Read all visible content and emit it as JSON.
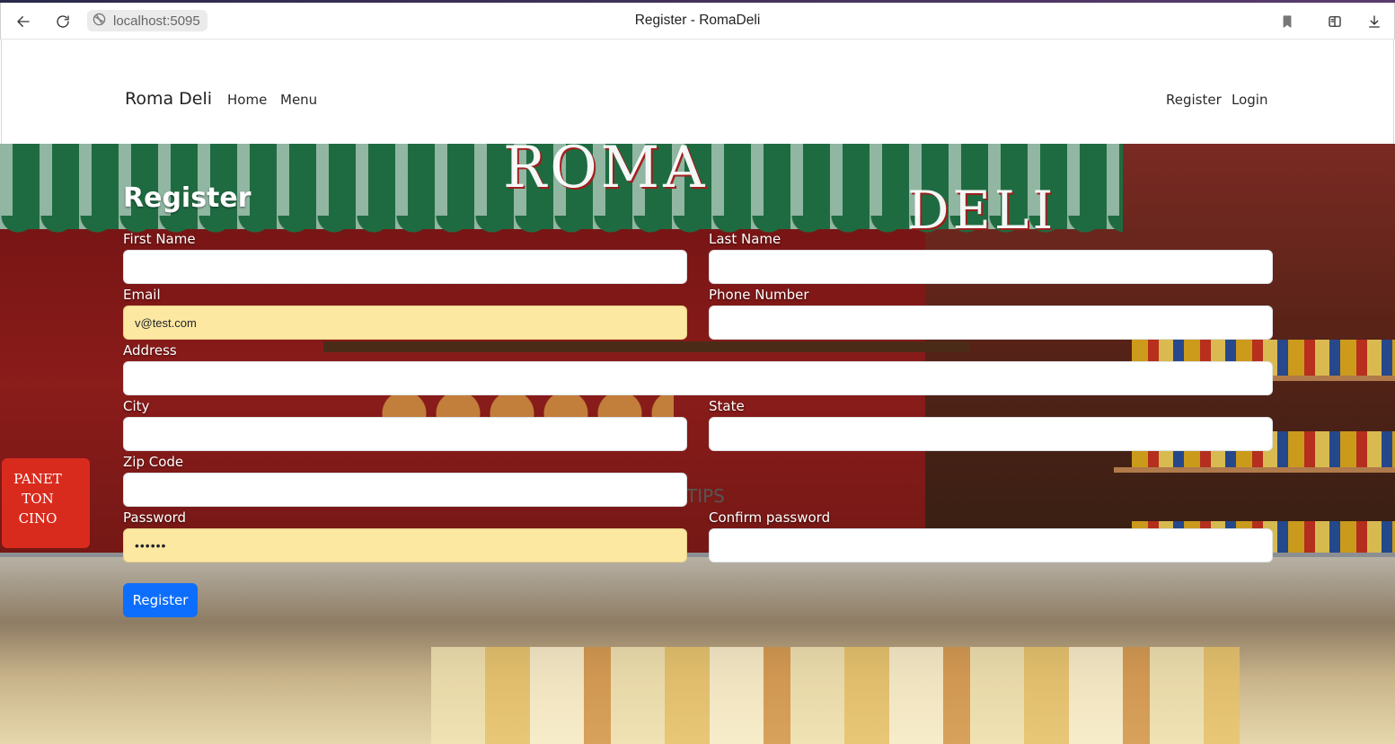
{
  "browser": {
    "url": "localhost:5095",
    "tab_title": "Register - RomaDeli",
    "icons": [
      "back-arrow-icon",
      "reload-icon",
      "site-info-icon",
      "bookmark-icon",
      "reading-list-icon",
      "download-icon"
    ]
  },
  "navbar": {
    "brand": "Roma Deli",
    "links": {
      "home": "Home",
      "menu": "Menu"
    },
    "auth": {
      "register": "Register",
      "login": "Login"
    }
  },
  "hero": {
    "awning_text_1": "ROMA",
    "awning_text_2": "DELI",
    "background_text_1": "PANET TON CINO",
    "background_text_2": "TIPS"
  },
  "form": {
    "title": "Register",
    "first_name": {
      "label": "First Name",
      "value": ""
    },
    "last_name": {
      "label": "Last Name",
      "value": ""
    },
    "email": {
      "label": "Email",
      "value": "v@test.com"
    },
    "phone": {
      "label": "Phone Number",
      "value": ""
    },
    "address": {
      "label": "Address",
      "value": ""
    },
    "city": {
      "label": "City",
      "value": ""
    },
    "state": {
      "label": "State",
      "value": ""
    },
    "zip": {
      "label": "Zip Code",
      "value": ""
    },
    "password": {
      "label": "Password",
      "value": "••••••"
    },
    "confirm_password": {
      "label": "Confirm password",
      "value": ""
    },
    "submit_label": "Register"
  },
  "colors": {
    "primary": "#0d6efd",
    "autofill": "#fde8a2",
    "awning_green": "#1f6b41",
    "wall_red": "#8a1c1a"
  }
}
